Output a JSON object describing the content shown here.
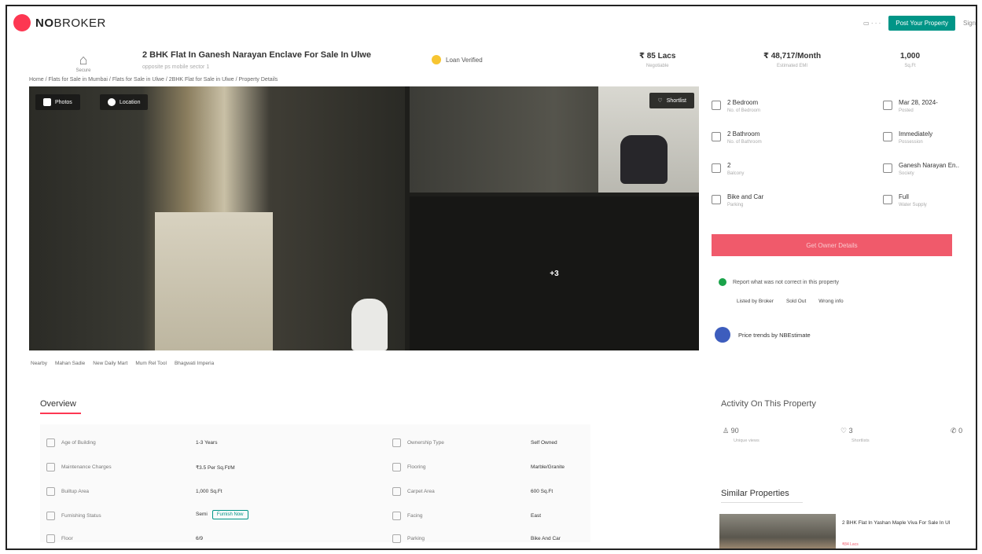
{
  "header": {
    "logo_bold": "NO",
    "logo_rest": "BROKER",
    "post_property": "Post Your Property",
    "sign_in": "Sign"
  },
  "property": {
    "icon_caption": "Secure",
    "title": "2 BHK Flat In Ganesh Narayan Enclave For Sale In Ulwe",
    "subtitle": "opposite ps mobile sector 1",
    "loan_badge": "Loan Verified",
    "price": "₹ 85 Lacs",
    "price_label": "Negotiable",
    "emi": "₹ 48,717/Month",
    "emi_label": "Estimated EMI",
    "area": "1,000",
    "area_label": "Sq.Ft"
  },
  "breadcrumb": "Home / Flats for Sale in Mumbai / Flats for Sale in Ulwe / 2BHK Flat for Sale in Ulwe / Property Details",
  "gallery": {
    "photos_chip": "Photos",
    "location_chip": "Location",
    "shortlist": "Shortlist",
    "more_count": "+3"
  },
  "nearby": [
    "Nearby",
    "Mahan Sadie",
    "New Daily Mart",
    "Mum Rel Tool",
    "Bhagwati Imperia"
  ],
  "details": [
    {
      "value": "2 Bedroom",
      "label": "No. of Bedroom",
      "icon": "bed-icon"
    },
    {
      "value": "Mar 28, 2024-",
      "label": "Posted",
      "icon": "calendar-icon"
    },
    {
      "value": "2 Bathroom",
      "label": "No. of Bathroom",
      "icon": "bath-icon"
    },
    {
      "value": "Immediately",
      "label": "Possession",
      "icon": "clock-icon"
    },
    {
      "value": "2",
      "label": "Balcony",
      "icon": "balcony-icon"
    },
    {
      "value": "Ganesh Narayan En..",
      "label": "Society",
      "icon": "building-icon"
    },
    {
      "value": "Bike and Car",
      "label": "Parking",
      "icon": "car-icon"
    },
    {
      "value": "Full",
      "label": "Water Supply",
      "icon": "water-icon"
    }
  ],
  "owner_button": "Get Owner Details",
  "report": {
    "text": "Report what was not correct in this property",
    "links": [
      "Listed by Broker",
      "Sold Out",
      "Wrong info"
    ]
  },
  "price_trends": "Price trends by NBEstimate",
  "overview": {
    "title": "Overview",
    "rows": [
      {
        "label": "Age of Building",
        "value": "1-3 Years",
        "label2": "Ownership Type",
        "value2": "Self Owned"
      },
      {
        "label": "Maintenance Charges",
        "value": "₹3.5 Per Sq.Ft/M",
        "label2": "Flooring",
        "value2": "Marble/Granite"
      },
      {
        "label": "Builtup Area",
        "value": "1,000 Sq.Ft",
        "label2": "Carpet Area",
        "value2": "600 Sq.Ft"
      },
      {
        "label": "Furnishing Status",
        "value": "Semi",
        "label2": "Facing",
        "value2": "East"
      },
      {
        "label": "Floor",
        "value": "6/9",
        "label2": "Parking",
        "value2": "Bike And Car"
      }
    ],
    "furnish_now": "Furnish Now"
  },
  "activity": {
    "title": "Activity On This Property",
    "items": [
      {
        "value": "90",
        "label": "Unique views"
      },
      {
        "value": "3",
        "label": "Shortlists"
      },
      {
        "value": "0",
        "label": ""
      }
    ]
  },
  "similar": {
    "title": "Similar Properties",
    "item_title": "2 BHK Flat In Yashan Maple Viva For Sale In Ul",
    "item_price": "₹84 Lacs"
  }
}
